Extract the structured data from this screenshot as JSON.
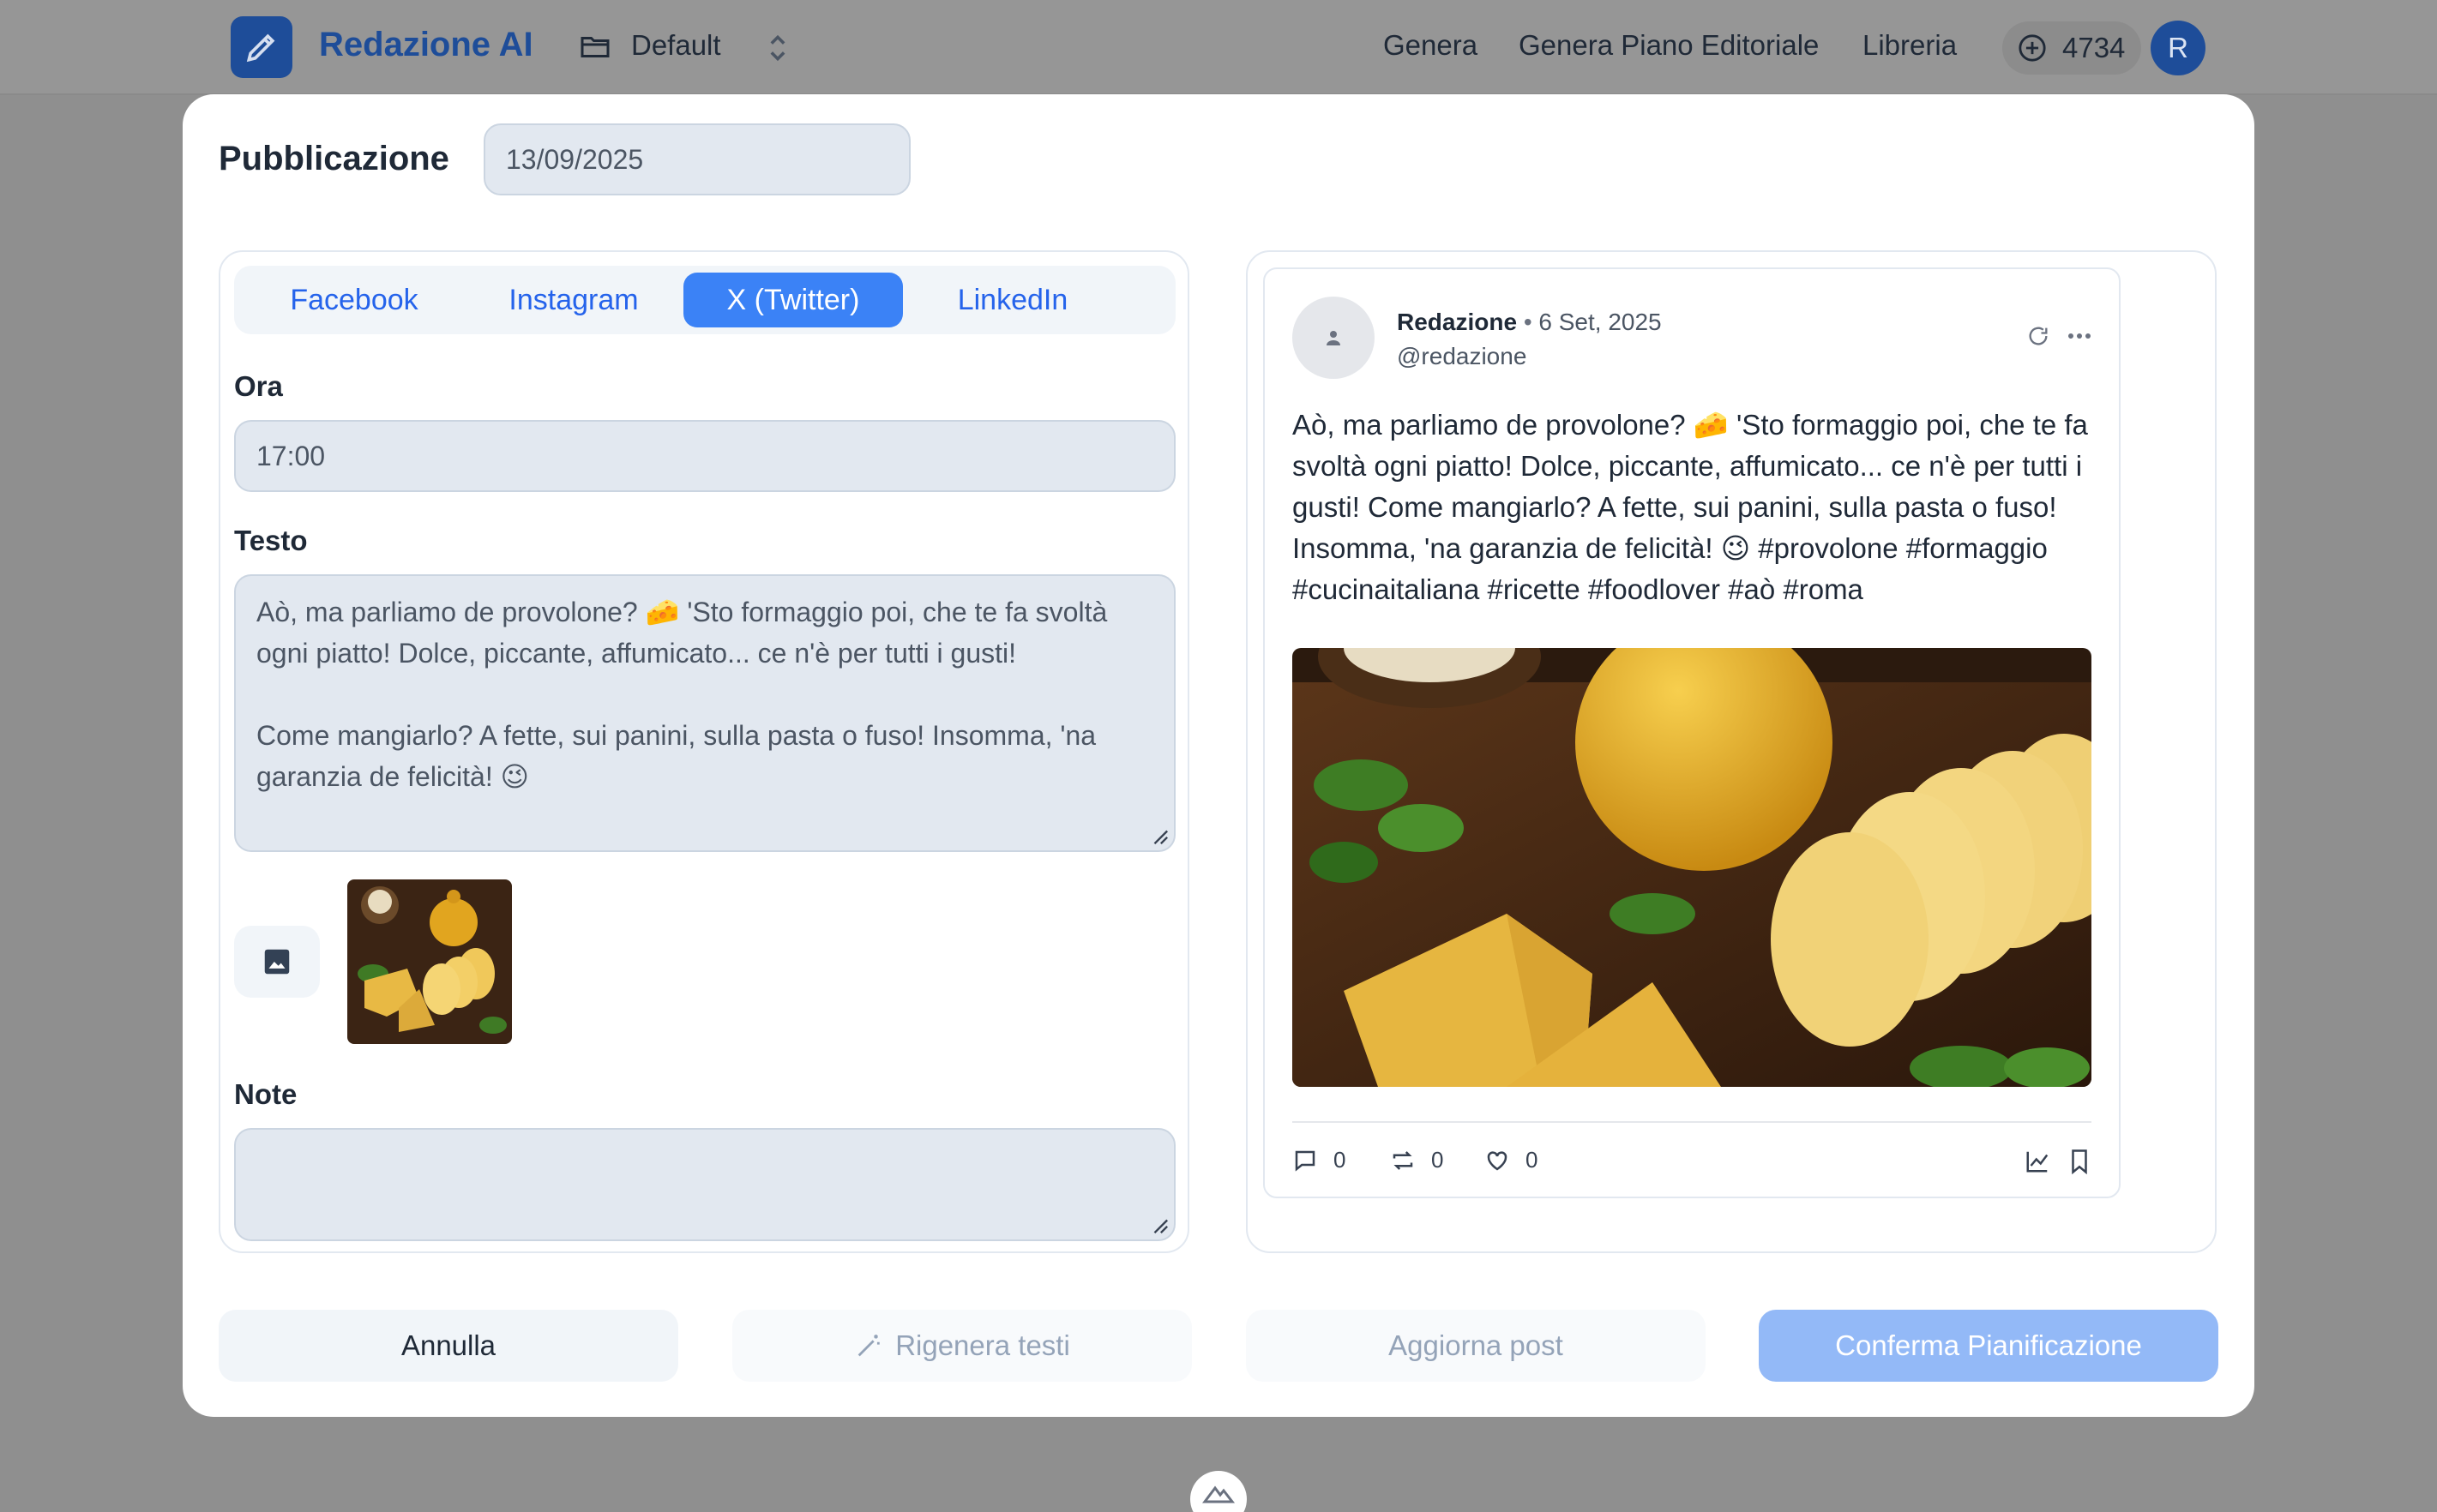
{
  "header": {
    "brand": "Redazione AI",
    "workspace": "Default",
    "nav": [
      "Genera",
      "Genera Piano Editoriale",
      "Libreria"
    ],
    "credits": "4734",
    "user_initial": "R"
  },
  "modal": {
    "publication_label": "Pubblicazione",
    "publication_date": "13/09/2025",
    "tabs": [
      {
        "label": "Facebook",
        "active": false
      },
      {
        "label": "Instagram",
        "active": false
      },
      {
        "label": "X (Twitter)",
        "active": true
      },
      {
        "label": "LinkedIn",
        "active": false
      }
    ],
    "time_label": "Ora",
    "time_value": "17:00",
    "text_label": "Testo",
    "text_value": "Aò, ma parliamo de provolone? 🧀 'Sto formaggio poi, che te fa svoltà ogni piatto! Dolce, piccante, affumicato... ce n'è per tutti i gusti!\n\nCome mangiarlo? A fette, sui panini, sulla pasta o fuso! Insomma, 'na garanzia de felicità! 😉",
    "notes_label": "Note",
    "notes_value": "",
    "preview": {
      "author": "Redazione",
      "separator": "•",
      "date": "6 Set, 2025",
      "handle": "@redazione",
      "text": "Aò, ma parliamo de provolone? 🧀 'Sto formaggio poi, che te fa svoltà ogni piatto! Dolce, piccante, affumicato... ce n'è per tutti i gusti! Come mangiarlo? A fette, sui panini, sulla pasta o fuso! Insomma, 'na garanzia de felicità! 😉 #provolone #formaggio #cucinaitaliana #ricette #foodlover #aò #roma",
      "replies": "0",
      "retweets": "0",
      "likes": "0"
    },
    "buttons": {
      "cancel": "Annulla",
      "regenerate": "Rigenera testi",
      "update": "Aggiorna post",
      "confirm": "Conferma Pianificazione"
    }
  },
  "colors": {
    "brand": "#1e4d99",
    "accent": "#3b82f6",
    "confirm_disabled": "#93b9f7"
  }
}
